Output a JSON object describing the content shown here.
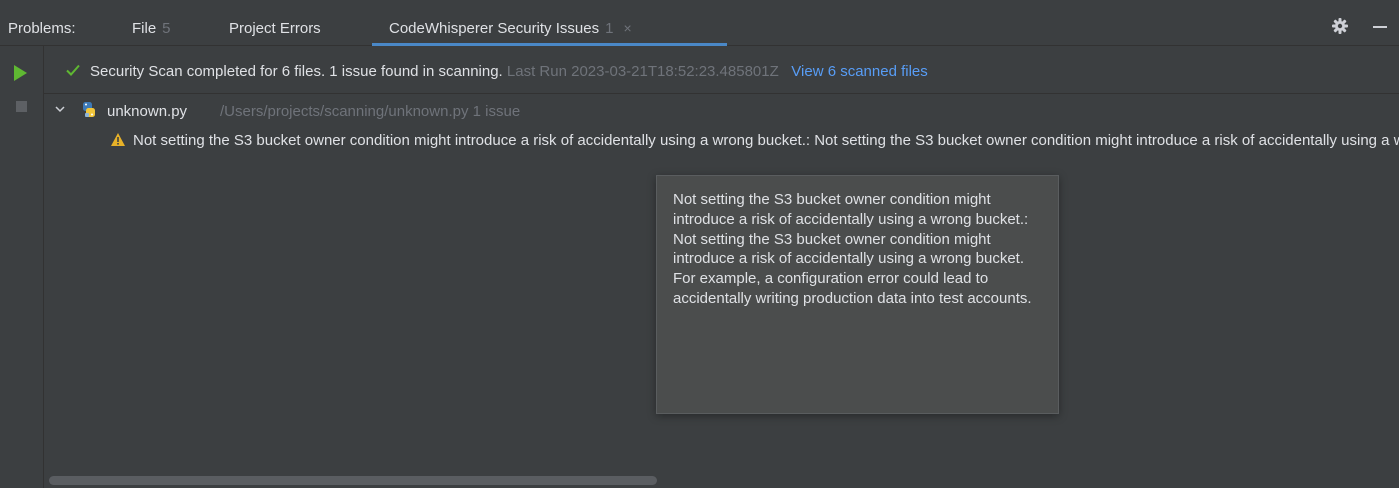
{
  "header": {
    "title": "Problems:",
    "tabs": [
      {
        "label": "File",
        "count": "5"
      },
      {
        "label": "Project Errors",
        "count": ""
      },
      {
        "label": "CodeWhisperer Security Issues",
        "count": "1",
        "active": true
      }
    ],
    "close_glyph": "×",
    "icons": [
      "gear-icon",
      "minimize-icon"
    ]
  },
  "toolbar": {
    "icons": [
      "run-icon",
      "stop-icon"
    ],
    "colors": {
      "run": "#5fb832",
      "stop": "#5d6064"
    }
  },
  "scan": {
    "status_text": "Security Scan completed for 6 files. 1 issue found in scanning.",
    "last_run_text": "Last Run 2023-03-21T18:52:23.485801Z",
    "view_link": "View 6 scanned files",
    "status_icon": "check-icon"
  },
  "tree": {
    "file": {
      "name": "unknown.py",
      "path": "/Users/projects/scanning/unknown.py",
      "issue_count": "1 issue",
      "icon": "python-file-icon"
    },
    "issues": [
      {
        "icon": "warning-icon",
        "text": "Not setting the S3 bucket owner condition might introduce a risk of accidentally using a wrong bucket.: Not setting the S3 bucket owner condition might introduce a risk of accidentally using a wrong bucket. For example, a configuration error could lead to accidentally writing production data into test accounts."
      }
    ]
  },
  "tooltip": {
    "text": "Not setting the S3 bucket owner condition might introduce a risk of accidentally using a wrong bucket.: Not setting the S3 bucket owner condition might introduce a risk of accidentally using a wrong bucket. For example, a configuration error could lead to accidentally writing production data into test accounts."
  },
  "colors": {
    "background": "#3c3f41",
    "accent": "#4a88c7",
    "link": "#589df6",
    "muted": "#6f737a",
    "warning": "#e8b228",
    "success": "#5fb832"
  }
}
